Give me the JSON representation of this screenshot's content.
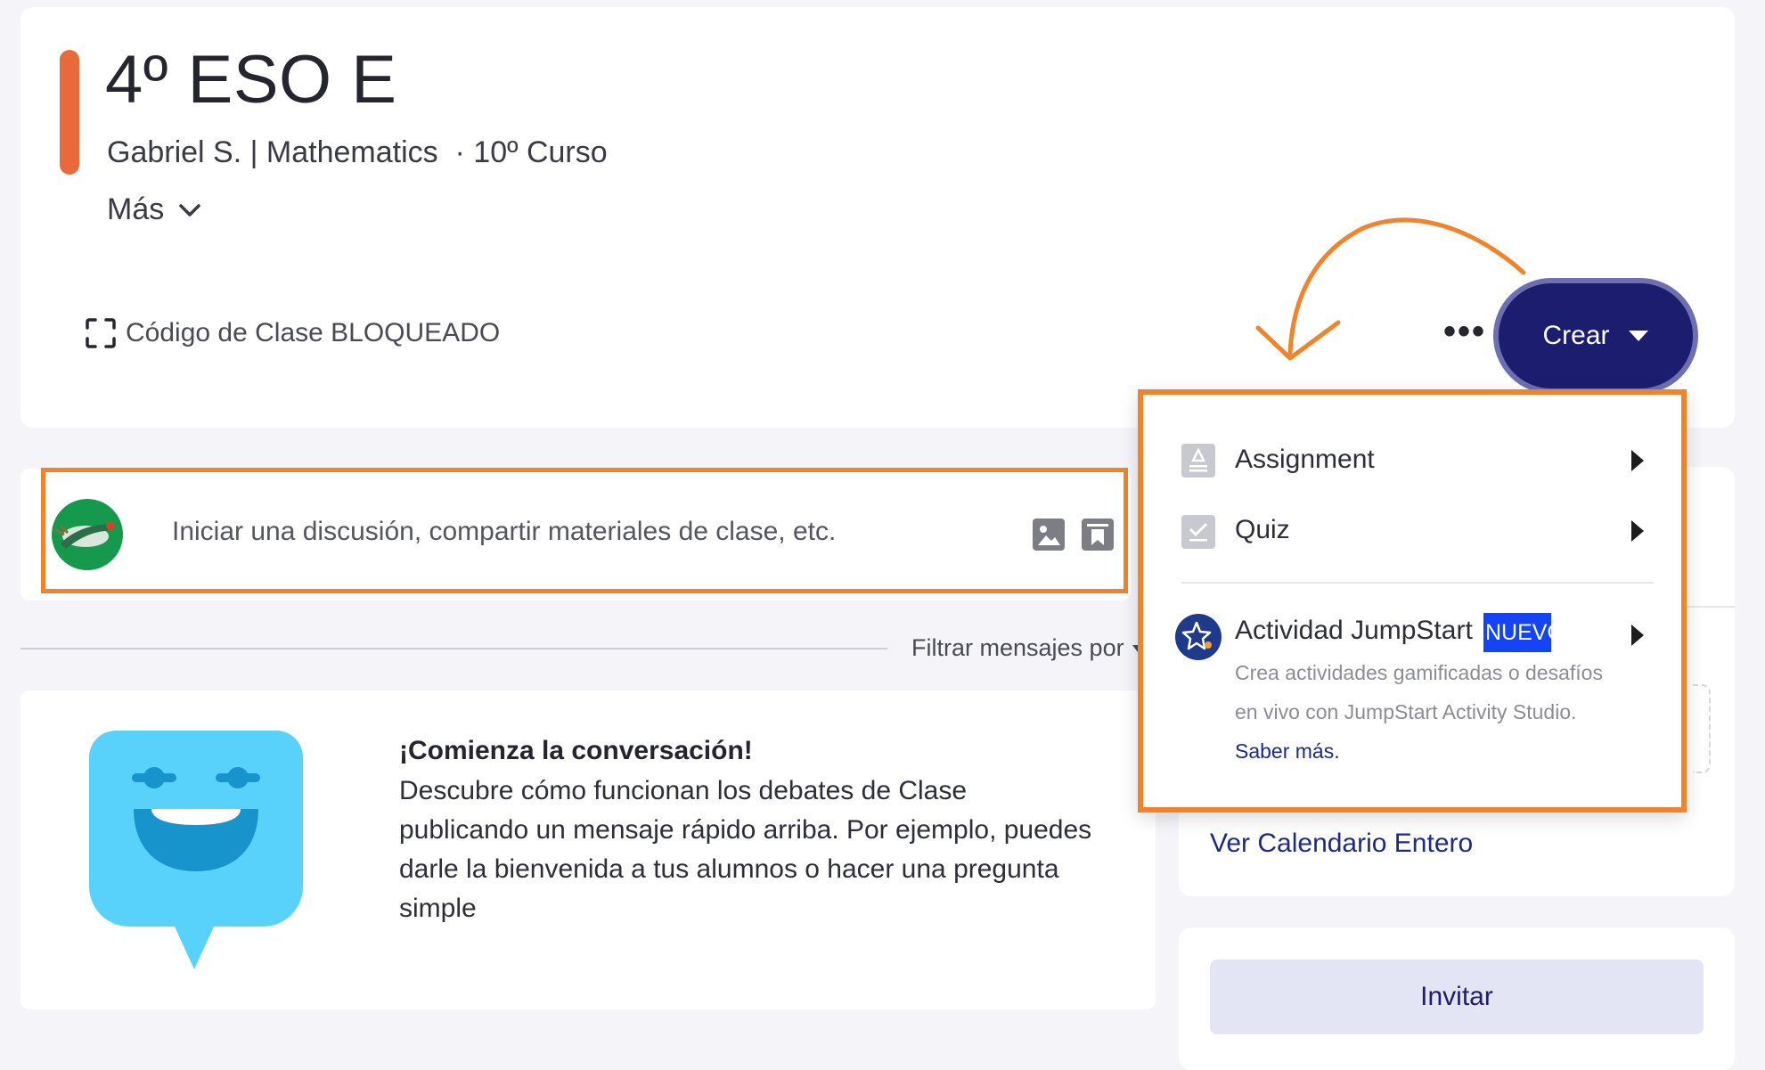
{
  "header": {
    "class_title": "4º ESO E",
    "subtitle": "Gabriel S. | Mathematics  · 10º Curso",
    "more_label": "Más",
    "class_code_label": "Código de Clase BLOQUEADO",
    "accent_color": "#e8693a"
  },
  "toolbar": {
    "more_options": "•••",
    "create_label": "Crear",
    "create_color": "#1c1d6e"
  },
  "composer": {
    "placeholder": "Iniciar una discusión, compartir materiales de clase, etc.",
    "icons": [
      "image-icon",
      "bookmark-icon"
    ]
  },
  "filter": {
    "label": "Filtrar mensajes por"
  },
  "empty_state": {
    "heading": "¡Comienza la conversación!",
    "body": "Descubre cómo funcionan los debates de Clase publicando un mensaje rápido arriba. Por ejemplo, puedes darle la bienvenida a tus alumnos o hacer una pregunta simple"
  },
  "dropdown": {
    "items": [
      {
        "label": "Assignment",
        "icon": "assignment-icon"
      },
      {
        "label": "Quiz",
        "icon": "quiz-icon"
      }
    ],
    "jumpstart": {
      "label": "Actividad JumpStart",
      "badge": "NUEVO",
      "description": "Crea actividades gamificadas o desafíos en vivo con JumpStart Activity Studio.",
      "learn_more": "Saber más.",
      "icon": "jumpstart-star-icon"
    },
    "highlight_color": "#f0842c"
  },
  "sidebar": {
    "calendar_link": "Ver Calendario Entero",
    "invite_label": "Invitar"
  }
}
